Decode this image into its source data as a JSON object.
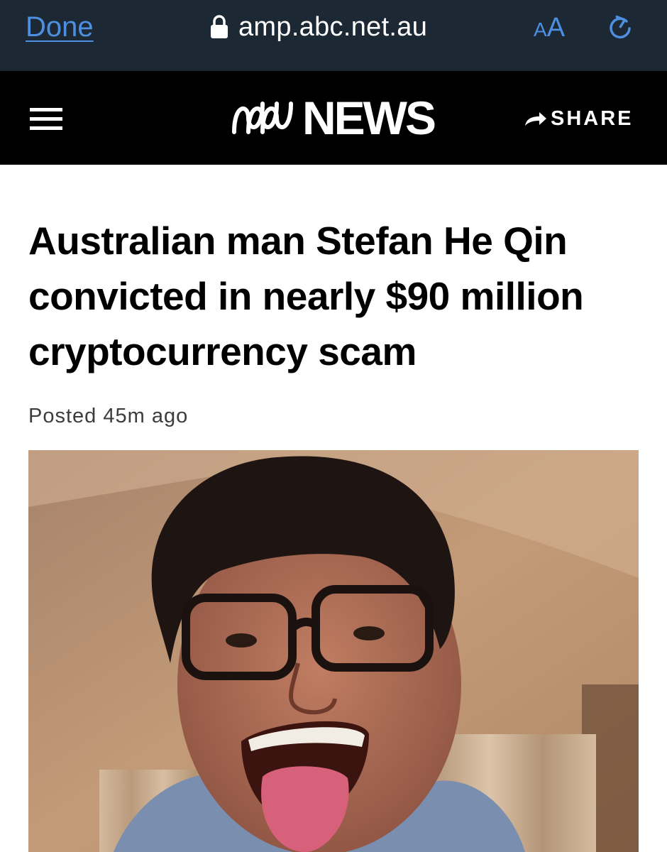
{
  "browser": {
    "done_label": "Done",
    "url": "amp.abc.net.au",
    "text_size_small": "A",
    "text_size_large": "A",
    "lock_icon": "lock-icon",
    "reload_icon": "reload-icon"
  },
  "header": {
    "logo_mark": "abc-logo-icon",
    "logo_text": "NEWS",
    "share_label": "SHARE",
    "menu_icon": "hamburger-menu-icon"
  },
  "article": {
    "headline": "Australian man Stefan He Qin convicted in nearly $90 million cryptocurrency scam",
    "posted": "Posted 45m ago",
    "photo": "photo of a young man with glasses sticking out his tongue"
  },
  "colors": {
    "browser_bar": "#1c2833",
    "link_blue": "#4d8fe0",
    "header_bg": "#000000"
  }
}
